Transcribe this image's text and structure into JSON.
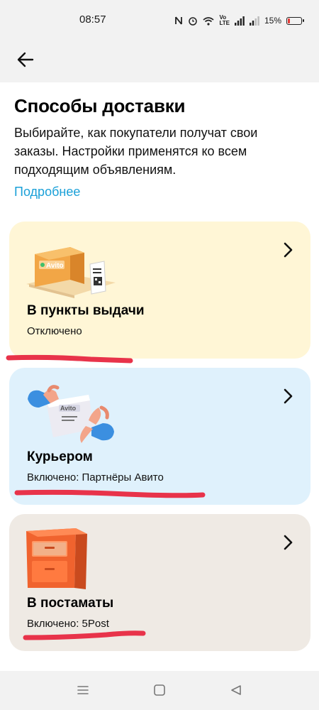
{
  "status_bar": {
    "time": "08:57",
    "network_label": "Vo\nLTE",
    "battery_percent": "15%",
    "battery_color": "#e53935"
  },
  "header": {
    "back_icon": "arrow-left-icon"
  },
  "page": {
    "title": "Способы доставки",
    "description": "Выбирайте, как покупатели получат свои заказы. Настройки применятся ко всем подходящим объявлениям.",
    "more_link": "Подробнее",
    "link_color": "#1aa0d8"
  },
  "options": [
    {
      "title": "В пункты выдачи",
      "status": "Отключено",
      "illustration": "avito-box-icon",
      "illustration_text": "Avito",
      "background": "#fff6d6"
    },
    {
      "title": "Курьером",
      "status": "Включено: Партнёры Авито",
      "illustration": "hands-package-icon",
      "illustration_text": "Avito",
      "background": "#dff1fc"
    },
    {
      "title": "В постаматы",
      "status": "Включено: 5Post",
      "illustration": "postamat-locker-icon",
      "background": "#efeae4"
    }
  ],
  "annotation_color": "#e8334a",
  "nav_bar": {
    "icons": [
      "menu-icon",
      "home-icon",
      "back-triangle-icon"
    ]
  }
}
